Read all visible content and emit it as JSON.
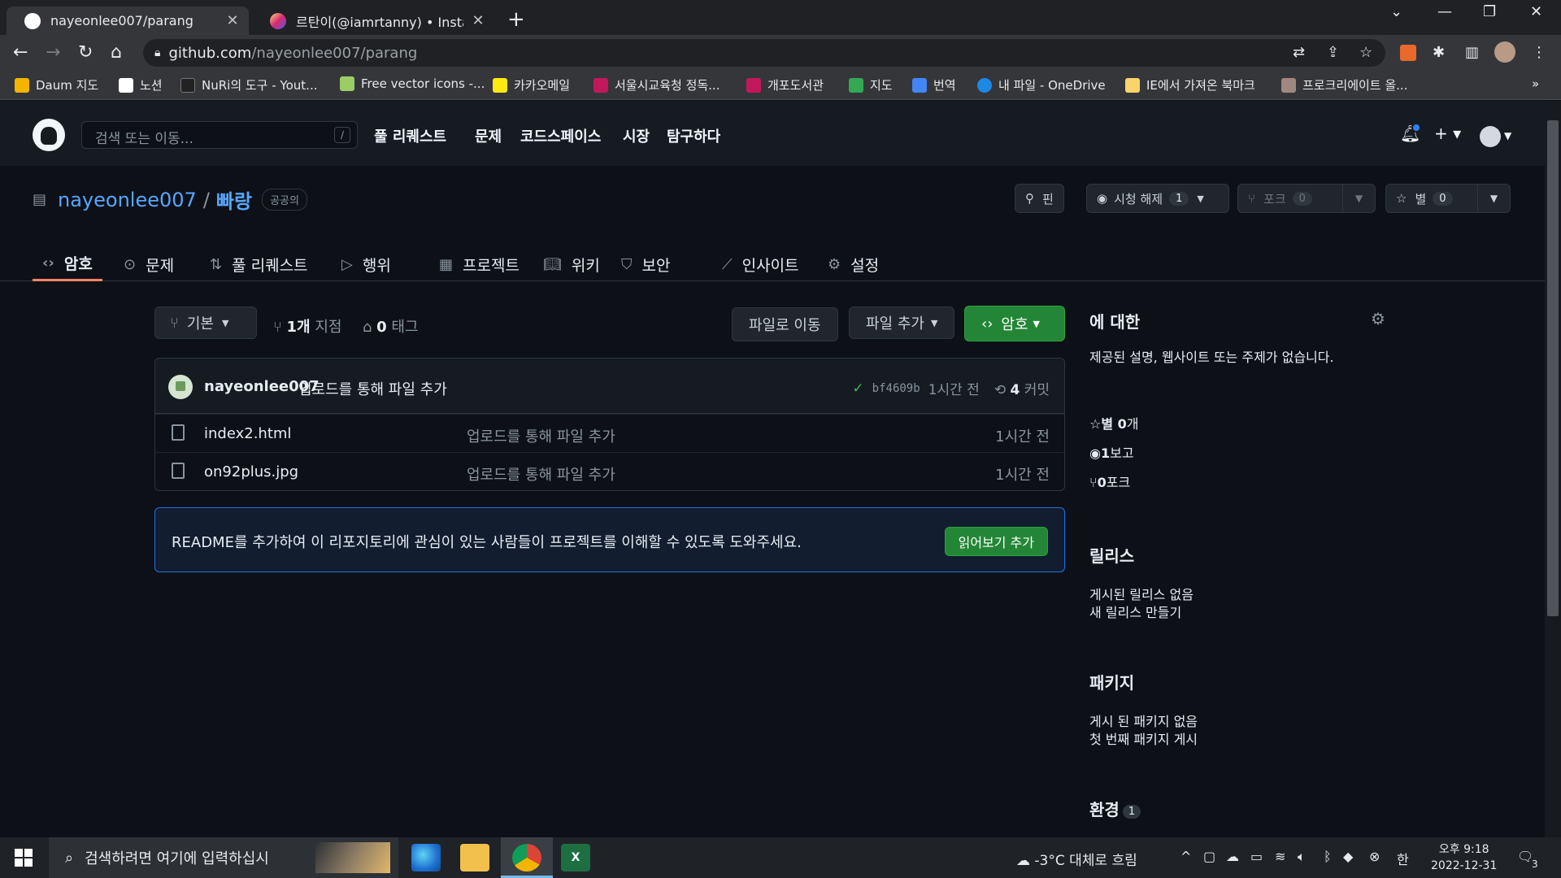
{
  "browser": {
    "tabs": [
      {
        "title": "nayeonlee007/parang",
        "close": "✕"
      },
      {
        "title": "르탄이(@iamrtanny) • Instagram",
        "close": "✕"
      }
    ],
    "new_tab": "+",
    "address": {
      "host": "github.com",
      "path": "/nayeonlee007/parang"
    },
    "bookmarks": [
      {
        "label": "Daum 지도",
        "color": "#f5b400"
      },
      {
        "label": "노션",
        "color": "#ffffff"
      },
      {
        "label": "NuRi의 도구 - Yout...",
        "color": "#222222"
      },
      {
        "label": "Free vector icons -...",
        "color": "#9ccc65"
      },
      {
        "label": "카카오메일",
        "color": "#ffe812"
      },
      {
        "label": "서울시교육청 정독...",
        "color": "#c2185b"
      },
      {
        "label": "개포도서관",
        "color": "#c2185b"
      },
      {
        "label": "지도",
        "color": "#34a853"
      },
      {
        "label": "번역",
        "color": "#4285f4"
      },
      {
        "label": "내 파일 - OneDrive",
        "color": "#1e88e5"
      },
      {
        "label": "IE에서 가져온 북마크",
        "color": "#f9d46b"
      },
      {
        "label": "프로크리에이트 올...",
        "color": "#a1887f"
      }
    ],
    "bookmarks_more": "»"
  },
  "github": {
    "search_placeholder": "검색 또는 이동...",
    "search_key": "/",
    "nav": [
      "풀 리퀘스트",
      "문제",
      "코드스페이스",
      "시장",
      "탐구하다"
    ]
  },
  "repo": {
    "owner": "nayeonlee007",
    "separator": "/",
    "name": "빠랑",
    "visibility": "공공의",
    "actions": {
      "pin": "핀",
      "watch": "시청 해제",
      "watch_count": "1",
      "fork": "포크",
      "fork_count": "0",
      "star": "별",
      "star_count": "0"
    },
    "tabs": [
      "암호",
      "문제",
      "풀 리퀘스트",
      "행위",
      "프로젝트",
      "위키",
      "보안",
      "인사이트",
      "설정"
    ]
  },
  "main": {
    "branch_button": "기본",
    "branches": {
      "count": "1개",
      "label": "지점"
    },
    "tags": {
      "count": "0",
      "label": "태그"
    },
    "goto_file": "파일로 이동",
    "add_file": "파일 추가",
    "code_button": "암호",
    "commit": {
      "author": "nayeonlee007",
      "message": "업로드를 통해 파일 추가",
      "sha": "bf4609b",
      "time": "1시간 전",
      "count": "4",
      "count_label": "커밋"
    },
    "files": [
      {
        "name": "index2.html",
        "message": "업로드를 통해 파일 추가",
        "time": "1시간 전"
      },
      {
        "name": "on92plus.jpg",
        "message": "업로드를 통해 파일 추가",
        "time": "1시간 전"
      }
    ],
    "readme": {
      "text": "README를 추가하여 이 리포지토리에 관심이 있는 사람들이 프로젝트를 이해할 수 있도록 도와주세요.",
      "button": "읽어보기 추가"
    }
  },
  "sidebar": {
    "about_title": "에 대한",
    "about_desc": "제공된 설명, 웹사이트 또는 주제가 없습니다.",
    "stars": {
      "count": "별 0",
      "label": "개"
    },
    "watching": {
      "count": "1",
      "label": "보고"
    },
    "forks": {
      "count": "0",
      "label": "포크"
    },
    "releases_title": "릴리스",
    "releases_none": "게시된 릴리스 없음",
    "releases_link": "새 릴리스 만들기",
    "packages_title": "패키지",
    "packages_none": "게시 된 패키지 없음",
    "packages_link": "첫 번째 패키지 게시",
    "env_title": "환경",
    "env_count": "1"
  },
  "taskbar": {
    "search_placeholder": "검색하려면 여기에 입력하십시",
    "weather": "-3°C  대체로 흐림",
    "ime": "한",
    "time": "오후 9:18",
    "date": "2022-12-31",
    "notification_count": "3"
  }
}
